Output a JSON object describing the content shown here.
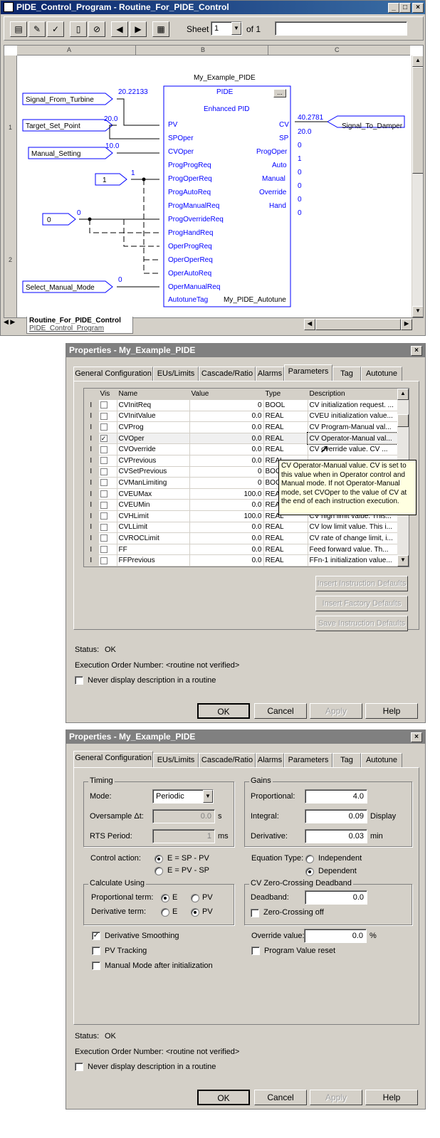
{
  "editor": {
    "title": "PIDE_Control_Program - Routine_For_PIDE_Control",
    "sheet_label": "Sheet",
    "sheet_value": "1",
    "of_label": "of 1",
    "columns": [
      "A",
      "B",
      "C"
    ],
    "rows": [
      "1",
      "2"
    ],
    "tab_title": "Routine_For_PIDE_Control",
    "tab_subtitle": "PIDE_Control_Program",
    "block": {
      "name": "My_Example_PIDE",
      "type": "PIDE",
      "subtitle": "Enhanced PID",
      "ellipsis": "...",
      "inputs": [
        "PV",
        "SPOper",
        "CVOper",
        "ProgProgReq",
        "ProgOperReq",
        "ProgAutoReq",
        "ProgManualReq",
        "ProgOverrideReq",
        "ProgHandReq",
        "OperProgReq",
        "OperOperReq",
        "OperAutoReq",
        "OperManualReq",
        "AutotuneTag"
      ],
      "outputs": [
        "CV",
        "SP",
        "ProgOper",
        "Auto",
        "Manual",
        "Override",
        "Hand"
      ],
      "output_values": [
        "40.2781",
        "20.0",
        "0",
        "1",
        "0",
        "0",
        "0",
        "0"
      ],
      "autotune_tag": "My_PIDE_Autotune"
    },
    "input_tags": [
      {
        "name": "Signal_From_Turbine",
        "value": "20.22133"
      },
      {
        "name": "Target_Set_Point",
        "value": "20.0"
      },
      {
        "name": "Manual_Setting",
        "value": "10.0"
      },
      {
        "name": "1",
        "value": "1"
      },
      {
        "name": "0",
        "value": "0"
      },
      {
        "name": "Select_Manual_Mode",
        "value": "0"
      }
    ],
    "output_tag": "Signal_To_Damper"
  },
  "dialog1": {
    "title": "Properties - My_Example_PIDE",
    "tabs": [
      "General Configuration",
      "EUs/Limits",
      "Cascade/Ratio",
      "Alarms",
      "Parameters",
      "Tag",
      "Autotune"
    ],
    "selected_tab": "Parameters",
    "headers": [
      "Vis",
      "Name",
      "Value",
      "Type",
      "Description"
    ],
    "rows": [
      {
        "io": "I",
        "vis": false,
        "name": "CVInitReq",
        "value": "0",
        "type": "BOOL",
        "desc": "CV initialization request. ..."
      },
      {
        "io": "I",
        "vis": false,
        "name": "CVInitValue",
        "value": "0.0",
        "type": "REAL",
        "desc": "CVEU initialization value..."
      },
      {
        "io": "I",
        "vis": false,
        "name": "CVProg",
        "value": "0.0",
        "type": "REAL",
        "desc": "CV Program-Manual val..."
      },
      {
        "io": "I",
        "vis": true,
        "name": "CVOper",
        "value": "0.0",
        "type": "REAL",
        "desc": "CV Operator-Manual val..."
      },
      {
        "io": "I",
        "vis": false,
        "name": "CVOverride",
        "value": "0.0",
        "type": "REAL",
        "desc": "CV override value.  CV ..."
      },
      {
        "io": "I",
        "vis": false,
        "name": "CVPrevious",
        "value": "0.0",
        "type": "REAL",
        "desc": ""
      },
      {
        "io": "I",
        "vis": false,
        "name": "CVSetPrevious",
        "value": "0",
        "type": "BOOL",
        "desc": ""
      },
      {
        "io": "I",
        "vis": false,
        "name": "CVManLimiting",
        "value": "0",
        "type": "BOOL",
        "desc": ""
      },
      {
        "io": "I",
        "vis": false,
        "name": "CVEUMax",
        "value": "100.0",
        "type": "REAL",
        "desc": ""
      },
      {
        "io": "I",
        "vis": false,
        "name": "CVEUMin",
        "value": "0.0",
        "type": "REAL",
        "desc": ""
      },
      {
        "io": "I",
        "vis": false,
        "name": "CVHLimit",
        "value": "100.0",
        "type": "REAL",
        "desc": "CV high limit value.  This..."
      },
      {
        "io": "I",
        "vis": false,
        "name": "CVLLimit",
        "value": "0.0",
        "type": "REAL",
        "desc": "CV low limit value.  This i..."
      },
      {
        "io": "I",
        "vis": false,
        "name": "CVROCLimit",
        "value": "0.0",
        "type": "REAL",
        "desc": "CV rate of change limit, i..."
      },
      {
        "io": "I",
        "vis": false,
        "name": "FF",
        "value": "0.0",
        "type": "REAL",
        "desc": "Feed forward value.  Th..."
      },
      {
        "io": "I",
        "vis": false,
        "name": "FFPrevious",
        "value": "0.0",
        "type": "REAL",
        "desc": "FFn-1 initialization value..."
      }
    ],
    "tooltip": "CV Operator-Manual value.  CV is set to this value when in Operator control and Manual mode. If not Operator-Manual mode, set CVOper to the value of CV at the end of each instruction execution.",
    "btn_insert_instr": "Insert Instruction Defaults",
    "btn_insert_factory": "Insert Factory Defaults",
    "btn_save_instr": "Save Instruction Defaults",
    "status_label": "Status:",
    "status_value": "OK",
    "exec_label": "Execution Order Number:",
    "exec_value": "<routine not verified>",
    "never_display": "Never display description in a routine",
    "ok": "OK",
    "cancel": "Cancel",
    "apply": "Apply",
    "help": "Help"
  },
  "dialog2": {
    "title": "Properties - My_Example_PIDE",
    "tabs": [
      "General Configuration",
      "EUs/Limits",
      "Cascade/Ratio",
      "Alarms",
      "Parameters",
      "Tag",
      "Autotune"
    ],
    "selected_tab": "General Configuration",
    "timing": {
      "label": "Timing",
      "mode_label": "Mode:",
      "mode_value": "Periodic",
      "oversample_label": "Oversample Δt:",
      "oversample_value": "0.0",
      "oversample_unit": "s",
      "rts_label": "RTS Period:",
      "rts_value": "1",
      "rts_unit": "ms"
    },
    "gains": {
      "label": "Gains",
      "prop_label": "Proportional:",
      "prop_value": "4.0",
      "int_label": "Integral:",
      "int_value": "0.09",
      "int_unit": "Display",
      "der_label": "Derivative:",
      "der_value": "0.03",
      "der_unit": "min"
    },
    "control_action_label": "Control action:",
    "ca_opt1": "E = SP - PV",
    "ca_opt2": "E = PV - SP",
    "equation_label": "Equation Type:",
    "eq_opt1": "Independent",
    "eq_opt2": "Dependent",
    "calc": {
      "label": "Calculate Using",
      "prop_label": "Proportional term:",
      "der_label": "Derivative term:",
      "opt_e": "E",
      "opt_pv": "PV"
    },
    "zero": {
      "label": "CV Zero-Crossing Deadband",
      "deadband_label": "Deadband:",
      "deadband_value": "0.0",
      "off_label": "Zero-Crossing off"
    },
    "deriv_smoothing": "Derivative Smoothing",
    "pv_tracking": "PV Tracking",
    "manual_after_init": "Manual Mode after initialization",
    "override_label": "Override value:",
    "override_value": "0.0",
    "override_unit": "%",
    "program_reset": "Program Value reset",
    "status_label": "Status:",
    "status_value": "OK",
    "exec_label": "Execution Order Number:",
    "exec_value": "<routine not verified>",
    "never_display": "Never display description in a routine",
    "ok": "OK",
    "cancel": "Cancel",
    "apply": "Apply",
    "help": "Help"
  },
  "colors": {
    "titlebar": "#0a246a",
    "face": "#d4d0c8",
    "wire": "#0000ff",
    "tooltip": "#ffffe1"
  }
}
